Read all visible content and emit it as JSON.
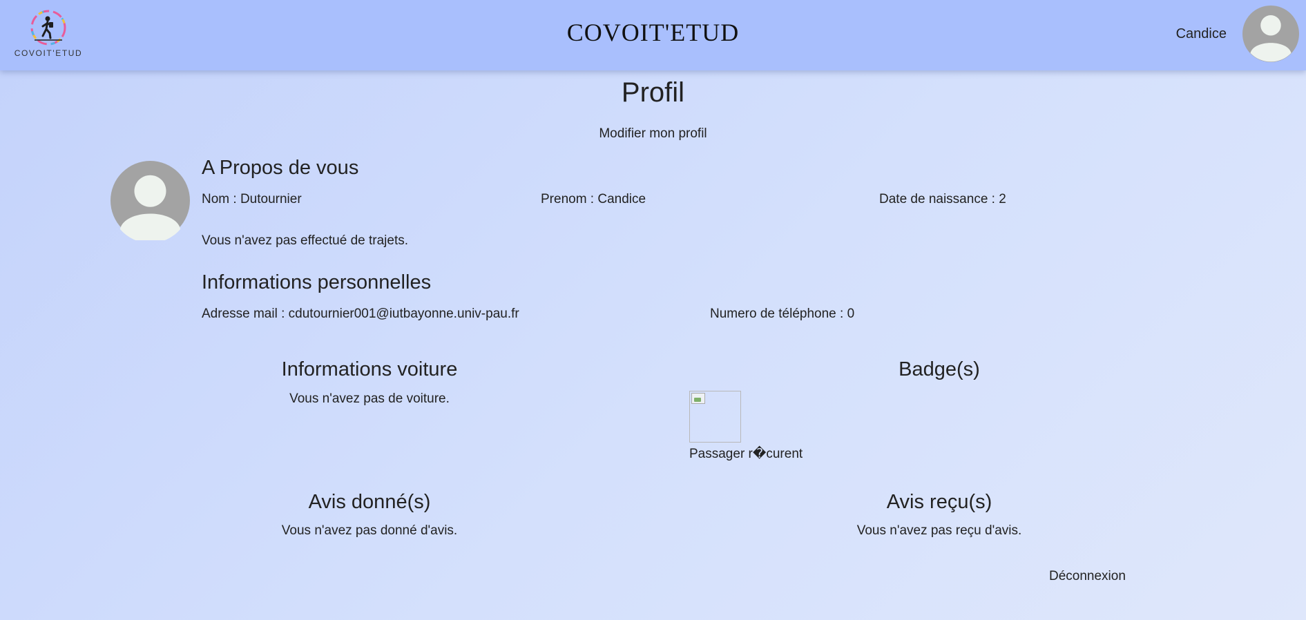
{
  "header": {
    "logo_text": "COVOIT'ETUD",
    "brand": "COVOIT'ETUD",
    "user_name": "Candice",
    "avatar_icon": "user-avatar-icon"
  },
  "page": {
    "title": "Profil",
    "edit_link": "Modifier mon profil"
  },
  "about": {
    "heading": "A Propos de vous",
    "nom": "Nom : Dutournier",
    "prenom": "Prenom : Candice",
    "birth": "Date de naissance : 2",
    "trips": "Vous n'avez pas effectué de trajets."
  },
  "personal": {
    "heading": "Informations personnelles",
    "email": "Adresse mail : cdutournier001@iutbayonne.univ-pau.fr",
    "phone": "Numero de téléphone : 0"
  },
  "car": {
    "heading": "Informations voiture",
    "text": "Vous n'avez pas de voiture."
  },
  "badges": {
    "heading": "Badge(s)",
    "items": [
      {
        "label": "Passager r�curent"
      }
    ]
  },
  "reviews_given": {
    "heading": "Avis donné(s)",
    "text": "Vous n'avez pas donné d'avis."
  },
  "reviews_received": {
    "heading": "Avis reçu(s)",
    "text": "Vous n'avez pas reçu d'avis."
  },
  "logout": "Déconnexion",
  "colors": {
    "header_bg": "#a9bffd",
    "page_bg": "#cfdcfc",
    "avatar_bg": "#a3a3a3",
    "avatar_fg": "#eef3ee"
  }
}
